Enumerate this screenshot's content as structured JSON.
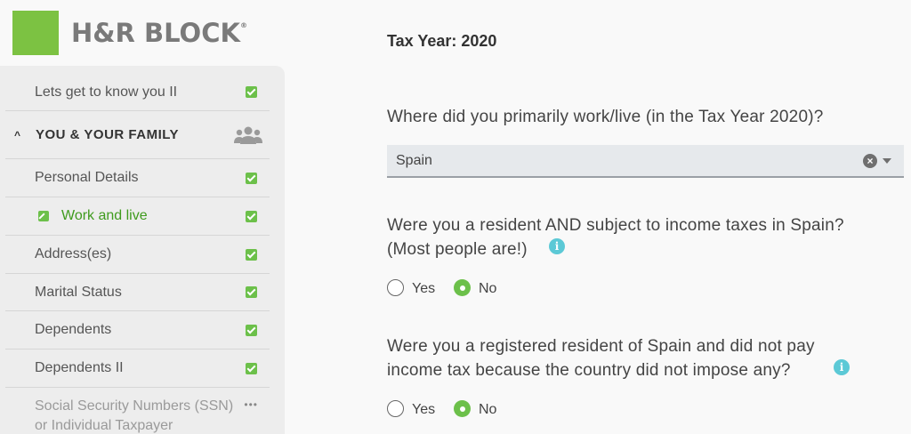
{
  "brand": {
    "name": "H&R BLOCK",
    "trademark": "®",
    "color": "#7cc242"
  },
  "sidebar": {
    "items": [
      {
        "label": "Lets get to know you II",
        "status": "complete"
      },
      {
        "label": "YOU & YOUR FAMILY",
        "type": "section",
        "expanded": true
      },
      {
        "label": "Personal Details",
        "status": "complete"
      },
      {
        "label": "Work and live",
        "status": "complete",
        "active": true
      },
      {
        "label": "Address(es)",
        "status": "complete"
      },
      {
        "label": "Marital Status",
        "status": "complete"
      },
      {
        "label": "Dependents",
        "status": "complete"
      },
      {
        "label": "Dependents II",
        "status": "complete"
      },
      {
        "label": "Social Security Numbers (SSN) or Individual Taxpayer",
        "status": "pending"
      }
    ]
  },
  "main": {
    "tax_year": "Tax Year: 2020",
    "q1": {
      "text": "Where did you primarily work/live (in the Tax Year 2020)?",
      "selected": "Spain"
    },
    "q2": {
      "line1": "Were you a resident AND subject to income taxes in Spain?",
      "line2": "(Most people are!)",
      "yes": "Yes",
      "no": "No",
      "selected": "No"
    },
    "q3": {
      "line1": "Were you a registered resident of Spain and did not pay",
      "line2": "income tax because the country did not impose any?",
      "yes": "Yes",
      "no": "No",
      "selected": "No"
    },
    "info_glyph": "i",
    "clear_glyph": "×"
  },
  "colors": {
    "accent_green": "#6cc04a",
    "active_text": "#3f9b1e",
    "info": "#5cc9d6"
  }
}
